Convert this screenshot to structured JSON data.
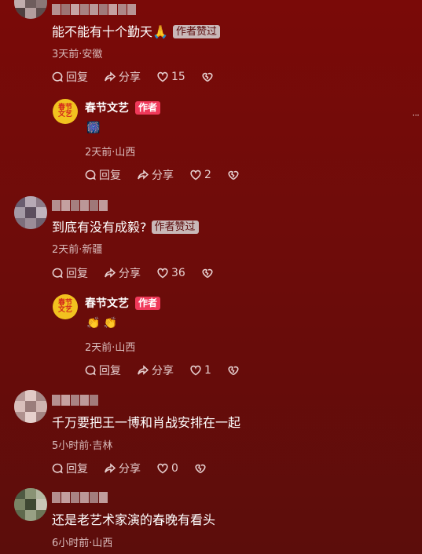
{
  "comments": [
    {
      "text": "能不能有十个勤天🙏",
      "badge": "作者赞过",
      "meta": "3天前·安徽",
      "reply_label": "回复",
      "share_label": "分享",
      "likes": "15",
      "reply": {
        "author_name": "春节文艺",
        "author_tag": "作者",
        "logo_text_top": "春节",
        "logo_text_bottom": "文艺",
        "content": "🎆",
        "meta": "2天前·山西",
        "reply_label": "回复",
        "share_label": "分享",
        "likes": "2"
      }
    },
    {
      "text": "到底有没有成毅?",
      "badge": "作者赞过",
      "meta": "2天前·新疆",
      "reply_label": "回复",
      "share_label": "分享",
      "likes": "36",
      "reply": {
        "author_name": "春节文艺",
        "author_tag": "作者",
        "logo_text_top": "春节",
        "logo_text_bottom": "文艺",
        "content": "👏 👏",
        "meta": "2天前·山西",
        "reply_label": "回复",
        "share_label": "分享",
        "likes": "1"
      }
    },
    {
      "text": "千万要把王一博和肖战安排在一起",
      "meta": "5小时前·吉林",
      "reply_label": "回复",
      "share_label": "分享",
      "likes": "0"
    },
    {
      "text": "还是老艺术家演的春晚有看头",
      "meta": "6小时前·山西"
    }
  ],
  "more_menu": "···",
  "icons": [
    "reply-icon",
    "share-icon",
    "like-icon",
    "dislike-icon"
  ]
}
